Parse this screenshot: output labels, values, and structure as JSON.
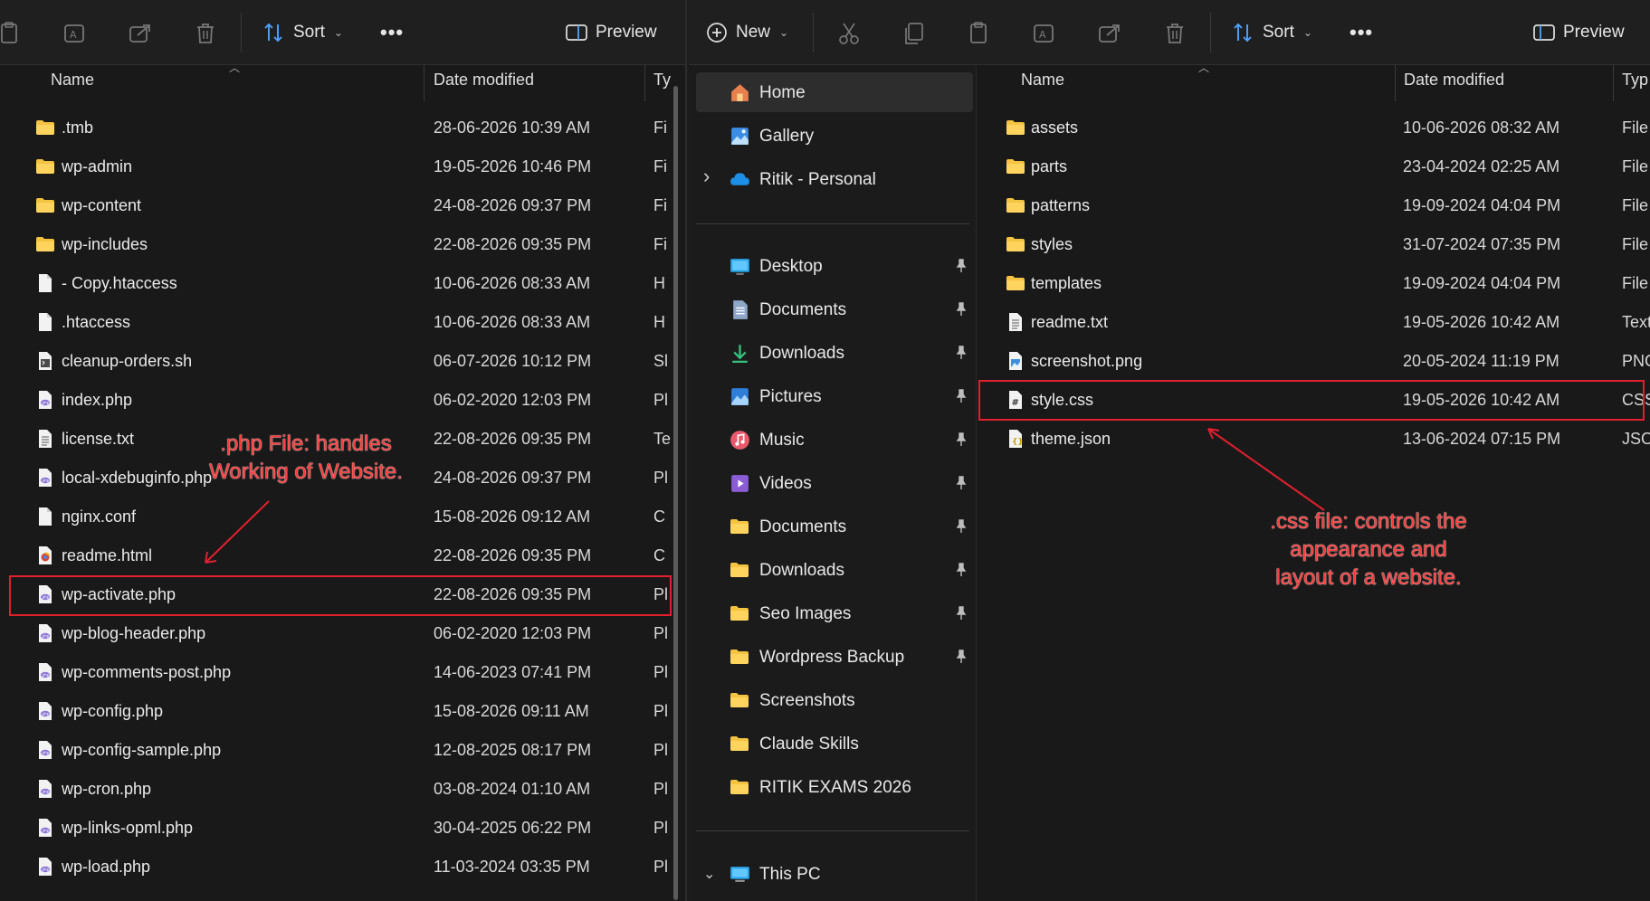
{
  "left": {
    "toolbar": {
      "sort_label": "Sort",
      "preview_label": "Preview",
      "more_label": "•••"
    },
    "columns": {
      "name": "Name",
      "date": "Date modified",
      "type": "Ty"
    },
    "rows": [
      {
        "icon": "folder",
        "name": ".tmb",
        "date": "28-06-2026 10:39 AM",
        "type": "Fi"
      },
      {
        "icon": "folder",
        "name": "wp-admin",
        "date": "19-05-2026 10:46 PM",
        "type": "Fi"
      },
      {
        "icon": "folder",
        "name": "wp-content",
        "date": "24-08-2026 09:37 PM",
        "type": "Fi"
      },
      {
        "icon": "folder",
        "name": "wp-includes",
        "date": "22-08-2026 09:35 PM",
        "type": "Fi"
      },
      {
        "icon": "file",
        "name": "- Copy.htaccess",
        "date": "10-06-2026 08:33 AM",
        "type": "H"
      },
      {
        "icon": "file",
        "name": ".htaccess",
        "date": "10-06-2026 08:33 AM",
        "type": "H"
      },
      {
        "icon": "script",
        "name": "cleanup-orders.sh",
        "date": "06-07-2026 10:12 PM",
        "type": "Sl"
      },
      {
        "icon": "php",
        "name": "index.php",
        "date": "06-02-2020 12:03 PM",
        "type": "Pl"
      },
      {
        "icon": "text",
        "name": "license.txt",
        "date": "22-08-2026 09:35 PM",
        "type": "Te"
      },
      {
        "icon": "php",
        "name": "local-xdebuginfo.php",
        "date": "24-08-2026 09:37 PM",
        "type": "Pl"
      },
      {
        "icon": "file",
        "name": "nginx.conf",
        "date": "15-08-2026 09:12 AM",
        "type": "C"
      },
      {
        "icon": "html",
        "name": "readme.html",
        "date": "22-08-2026 09:35 PM",
        "type": "C"
      },
      {
        "icon": "php",
        "name": "wp-activate.php",
        "date": "22-08-2026 09:35 PM",
        "type": "Pl"
      },
      {
        "icon": "php",
        "name": "wp-blog-header.php",
        "date": "06-02-2020 12:03 PM",
        "type": "Pl"
      },
      {
        "icon": "php",
        "name": "wp-comments-post.php",
        "date": "14-06-2023 07:41 PM",
        "type": "Pl"
      },
      {
        "icon": "php",
        "name": "wp-config.php",
        "date": "15-08-2026 09:11 AM",
        "type": "Pl"
      },
      {
        "icon": "php",
        "name": "wp-config-sample.php",
        "date": "12-08-2025 08:17 PM",
        "type": "Pl"
      },
      {
        "icon": "php",
        "name": "wp-cron.php",
        "date": "03-08-2024 01:10 AM",
        "type": "Pl"
      },
      {
        "icon": "php",
        "name": "wp-links-opml.php",
        "date": "30-04-2025 06:22 PM",
        "type": "Pl"
      },
      {
        "icon": "php",
        "name": "wp-load.php",
        "date": "11-03-2024 03:35 PM",
        "type": "Pl"
      }
    ],
    "annotation": {
      "line1": ".php File: handles",
      "line2": "Working of Website."
    }
  },
  "right": {
    "toolbar": {
      "new_label": "New",
      "sort_label": "Sort",
      "preview_label": "Preview",
      "more_label": "•••"
    },
    "nav": [
      {
        "icon": "home",
        "label": "Home",
        "selected": true
      },
      {
        "icon": "gallery",
        "label": "Gallery"
      },
      {
        "icon": "cloud",
        "label": "Ritik - Personal",
        "expandable": true
      },
      {
        "icon": "desktop",
        "label": "Desktop",
        "pinned": true
      },
      {
        "icon": "documents",
        "label": "Documents",
        "pinned": true
      },
      {
        "icon": "downloads",
        "label": "Downloads",
        "pinned": true
      },
      {
        "icon": "pictures",
        "label": "Pictures",
        "pinned": true
      },
      {
        "icon": "music",
        "label": "Music",
        "pinned": true
      },
      {
        "icon": "videos",
        "label": "Videos",
        "pinned": true
      },
      {
        "icon": "folder",
        "label": "Documents",
        "pinned": true
      },
      {
        "icon": "folder",
        "label": "Downloads",
        "pinned": true
      },
      {
        "icon": "folder",
        "label": "Seo Images",
        "pinned": true
      },
      {
        "icon": "folder",
        "label": "Wordpress Backup",
        "pinned": true
      },
      {
        "icon": "folder",
        "label": "Screenshots"
      },
      {
        "icon": "folder",
        "label": "Claude Skills"
      },
      {
        "icon": "folder",
        "label": "RITIK EXAMS 2026"
      },
      {
        "icon": "pc",
        "label": "This PC",
        "expanded": true
      }
    ],
    "columns": {
      "name": "Name",
      "date": "Date modified",
      "type": "Typ"
    },
    "rows": [
      {
        "icon": "folder",
        "name": "assets",
        "date": "10-06-2026 08:32 AM",
        "type": "File"
      },
      {
        "icon": "folder",
        "name": "parts",
        "date": "23-04-2024 02:25 AM",
        "type": "File"
      },
      {
        "icon": "folder",
        "name": "patterns",
        "date": "19-09-2024 04:04 PM",
        "type": "File"
      },
      {
        "icon": "folder",
        "name": "styles",
        "date": "31-07-2024 07:35 PM",
        "type": "File"
      },
      {
        "icon": "folder",
        "name": "templates",
        "date": "19-09-2024 04:04 PM",
        "type": "File"
      },
      {
        "icon": "text",
        "name": "readme.txt",
        "date": "19-05-2026 10:42 AM",
        "type": "Text"
      },
      {
        "icon": "image",
        "name": "screenshot.png",
        "date": "20-05-2024 11:19 PM",
        "type": "PNG"
      },
      {
        "icon": "css",
        "name": "style.css",
        "date": "19-05-2026 10:42 AM",
        "type": "CSS"
      },
      {
        "icon": "json",
        "name": "theme.json",
        "date": "13-06-2024 07:15 PM",
        "type": "JSO"
      }
    ],
    "annotation": {
      "line1": ".css file: controls the",
      "line2": "appearance and",
      "line3": "layout of a website."
    }
  },
  "colors": {
    "annotation": "#ff3b3b",
    "highlight": "#e0202e",
    "folder": "#f5c342",
    "php": "#8a74d6",
    "background": "#191919"
  }
}
